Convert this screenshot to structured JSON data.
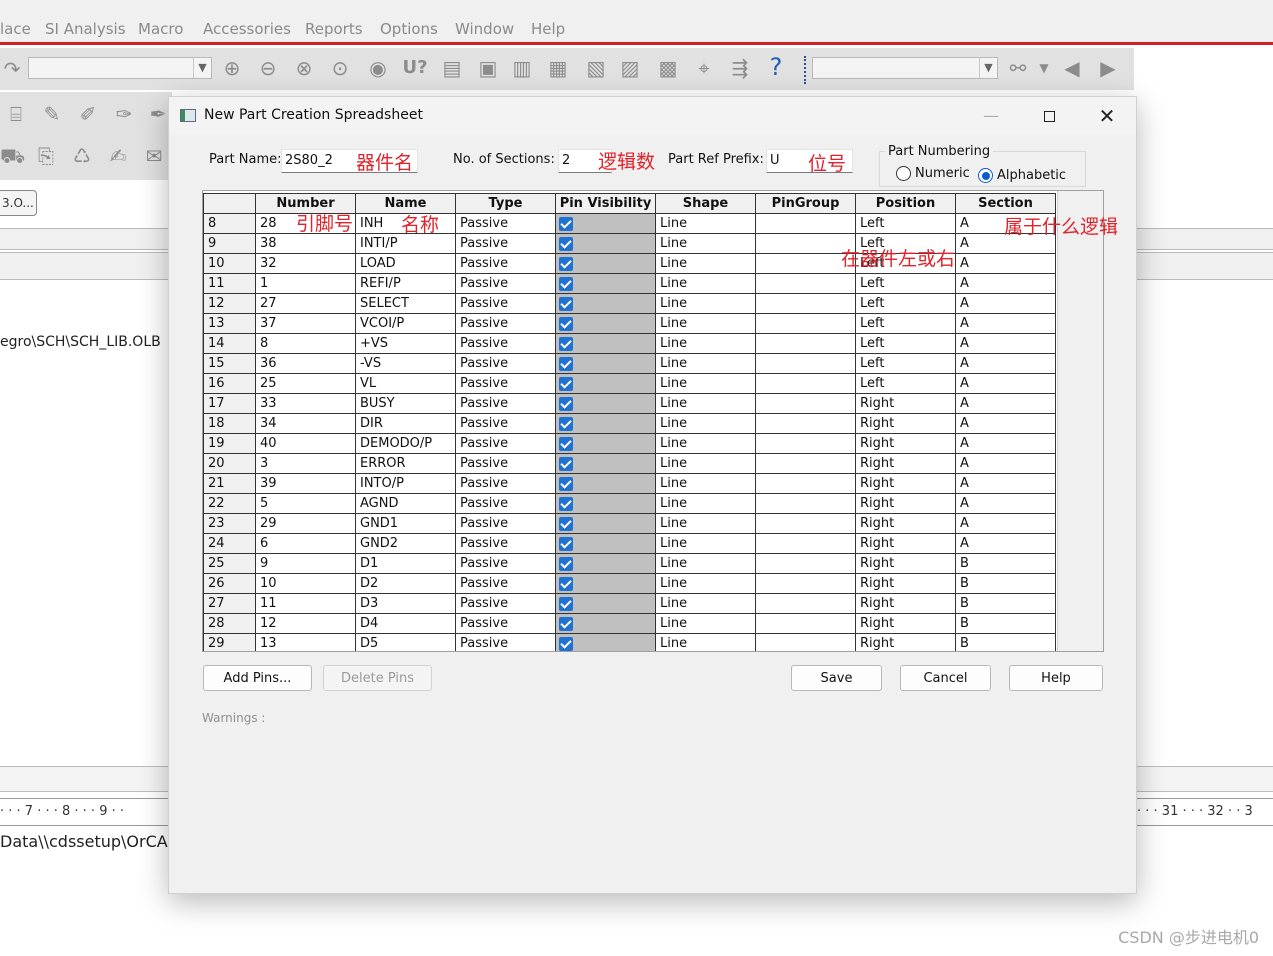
{
  "app": {
    "menu": [
      "lace",
      "SI Analysis",
      "Macro",
      "Accessories",
      "Reports",
      "Options",
      "Window",
      "Help"
    ],
    "tab_label": "3.O...",
    "path_fragment": "egro\\SCH\\SCH_LIB.OLB",
    "ruler_left": "· · · 7 · · · 8 · · · 9 · ·",
    "ruler_right": "· · · 31 · · · 32 · · 3",
    "status_fragment": "Data\\\\cdssetup\\OrCA",
    "toolbar_icon_label": "U?",
    "watermark": "CSDN @步进电机0"
  },
  "dialog": {
    "title": "New Part Creation Spreadsheet",
    "part_name_label": "Part Name:",
    "part_name_value": "2S80_2",
    "sections_label": "No. of Sections:",
    "sections_value": "2",
    "prefix_label": "Part Ref Prefix:",
    "prefix_value": "U",
    "numbering": {
      "title": "Part Numbering",
      "numeric_label": "Numeric",
      "alphabetic_label": "Alphabetic",
      "selected": "Alphabetic"
    },
    "columns": [
      "",
      "Number",
      "Name",
      "Type",
      "Pin Visibility",
      "Shape",
      "PinGroup",
      "Position",
      "Section"
    ],
    "rows": [
      {
        "row": "8",
        "number": "28",
        "name": "INH",
        "type": "Passive",
        "shape": "Line",
        "pingroup": "",
        "position": "Left",
        "section": "A"
      },
      {
        "row": "9",
        "number": "38",
        "name": "INTI/P",
        "type": "Passive",
        "shape": "Line",
        "pingroup": "",
        "position": "Left",
        "section": "A"
      },
      {
        "row": "10",
        "number": "32",
        "name": "LOAD",
        "type": "Passive",
        "shape": "Line",
        "pingroup": "",
        "position": "Left",
        "section": "A"
      },
      {
        "row": "11",
        "number": "1",
        "name": "REFI/P",
        "type": "Passive",
        "shape": "Line",
        "pingroup": "",
        "position": "Left",
        "section": "A"
      },
      {
        "row": "12",
        "number": "27",
        "name": "SELECT",
        "type": "Passive",
        "shape": "Line",
        "pingroup": "",
        "position": "Left",
        "section": "A"
      },
      {
        "row": "13",
        "number": "37",
        "name": "VCOI/P",
        "type": "Passive",
        "shape": "Line",
        "pingroup": "",
        "position": "Left",
        "section": "A"
      },
      {
        "row": "14",
        "number": "8",
        "name": "+VS",
        "type": "Passive",
        "shape": "Line",
        "pingroup": "",
        "position": "Left",
        "section": "A"
      },
      {
        "row": "15",
        "number": "36",
        "name": "-VS",
        "type": "Passive",
        "shape": "Line",
        "pingroup": "",
        "position": "Left",
        "section": "A"
      },
      {
        "row": "16",
        "number": "25",
        "name": "VL",
        "type": "Passive",
        "shape": "Line",
        "pingroup": "",
        "position": "Left",
        "section": "A"
      },
      {
        "row": "17",
        "number": "33",
        "name": "BUSY",
        "type": "Passive",
        "shape": "Line",
        "pingroup": "",
        "position": "Right",
        "section": "A"
      },
      {
        "row": "18",
        "number": "34",
        "name": "DIR",
        "type": "Passive",
        "shape": "Line",
        "pingroup": "",
        "position": "Right",
        "section": "A"
      },
      {
        "row": "19",
        "number": "40",
        "name": "DEMODO/P",
        "type": "Passive",
        "shape": "Line",
        "pingroup": "",
        "position": "Right",
        "section": "A"
      },
      {
        "row": "20",
        "number": "3",
        "name": "ERROR",
        "type": "Passive",
        "shape": "Line",
        "pingroup": "",
        "position": "Right",
        "section": "A"
      },
      {
        "row": "21",
        "number": "39",
        "name": "INTO/P",
        "type": "Passive",
        "shape": "Line",
        "pingroup": "",
        "position": "Right",
        "section": "A"
      },
      {
        "row": "22",
        "number": "5",
        "name": "AGND",
        "type": "Passive",
        "shape": "Line",
        "pingroup": "",
        "position": "Right",
        "section": "A"
      },
      {
        "row": "23",
        "number": "29",
        "name": "GND1",
        "type": "Passive",
        "shape": "Line",
        "pingroup": "",
        "position": "Right",
        "section": "A"
      },
      {
        "row": "24",
        "number": "6",
        "name": "GND2",
        "type": "Passive",
        "shape": "Line",
        "pingroup": "",
        "position": "Right",
        "section": "A"
      },
      {
        "row": "25",
        "number": "9",
        "name": "D1",
        "type": "Passive",
        "shape": "Line",
        "pingroup": "",
        "position": "Right",
        "section": "B"
      },
      {
        "row": "26",
        "number": "10",
        "name": "D2",
        "type": "Passive",
        "shape": "Line",
        "pingroup": "",
        "position": "Right",
        "section": "B"
      },
      {
        "row": "27",
        "number": "11",
        "name": "D3",
        "type": "Passive",
        "shape": "Line",
        "pingroup": "",
        "position": "Right",
        "section": "B"
      },
      {
        "row": "28",
        "number": "12",
        "name": "D4",
        "type": "Passive",
        "shape": "Line",
        "pingroup": "",
        "position": "Right",
        "section": "B"
      },
      {
        "row": "29",
        "number": "13",
        "name": "D5",
        "type": "Passive",
        "shape": "Line",
        "pingroup": "",
        "position": "Right",
        "section": "B"
      }
    ],
    "buttons": {
      "add_pins": "Add Pins...",
      "delete_pins": "Delete Pins",
      "save": "Save",
      "cancel": "Cancel",
      "help": "Help"
    },
    "warnings_label": "Warnings :"
  },
  "annotations": {
    "part_name": "器件名",
    "sections": "逻辑数",
    "prefix": "位号",
    "pin_number": "引脚号",
    "pin_name": "名称",
    "section": "属于什么逻辑",
    "position": "在器件左或右"
  },
  "colors": {
    "accent_red": "#d21f26",
    "annotation_red": "#e2222a",
    "checkbox_blue": "#1f72d1",
    "visibility_fill": "#c0c0c0"
  }
}
